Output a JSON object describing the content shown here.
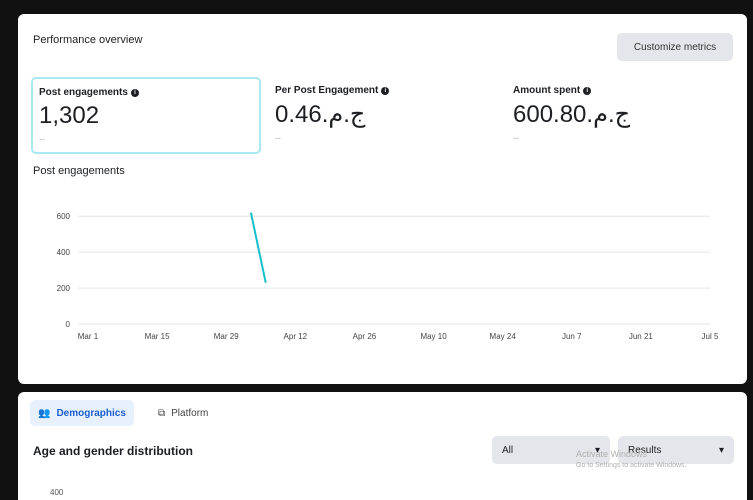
{
  "overview": {
    "title": "Performance overview",
    "customize_label": "Customize metrics"
  },
  "metrics": [
    {
      "label": "Post engagements",
      "value": "1,302",
      "sub": "--"
    },
    {
      "label": "Per Post Engagement",
      "value": "0.46.ج.م",
      "sub": "--"
    },
    {
      "label": "Amount spent",
      "value": "600.80.ج.م",
      "sub": "--"
    }
  ],
  "icons": {
    "info": "info-icon",
    "demographics": "people-icon",
    "platform": "platform-icon",
    "dropdown": "chevron-down-icon"
  },
  "chart_data": {
    "type": "line",
    "title": "Post engagements",
    "x_ticks": [
      "Mar 1",
      "Mar 15",
      "Mar 29",
      "Apr 12",
      "Apr 26",
      "May 10",
      "May 24",
      "Jun 7",
      "Jun 21",
      "Jul 5"
    ],
    "y_ticks": [
      0,
      200,
      400,
      600
    ],
    "ylim": [
      0,
      600
    ],
    "grid": true,
    "series": [
      {
        "color": "#17c0c9",
        "points": [
          {
            "x": "Apr 6",
            "y": 620
          },
          {
            "x": "Apr 9",
            "y": 230
          }
        ]
      }
    ]
  },
  "bottom": {
    "tabs": [
      {
        "label": "Demographics",
        "active": true
      },
      {
        "label": "Platform",
        "active": false
      }
    ],
    "section_title": "Age and gender distribution",
    "filter_all": "All",
    "filter_results": "Results",
    "age_axis_top": "400"
  },
  "watermark": {
    "line1": "Activate Windows",
    "line2": "Go to Settings to activate Windows."
  }
}
